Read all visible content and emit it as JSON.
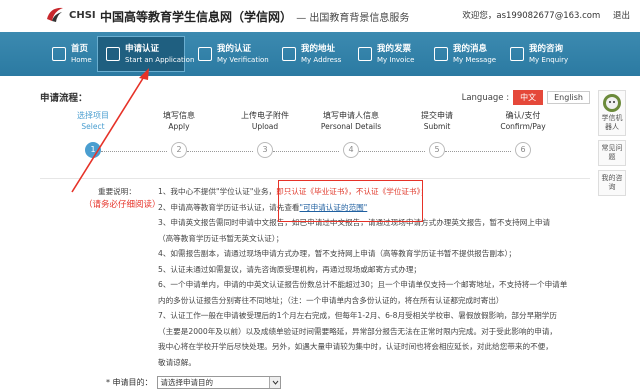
{
  "header": {
    "brand": "CHSI",
    "title": "中国高等教育学生信息网（学信网）",
    "subtitle": "— 出国教育背景信息服务",
    "welcome": "欢迎您，as199082677@163.com",
    "logout": "退出"
  },
  "nav": [
    {
      "cn": "首页",
      "en": "Home",
      "icon": "home-icon"
    },
    {
      "cn": "申请认证",
      "en": "Start an Application",
      "icon": "application-icon"
    },
    {
      "cn": "我的认证",
      "en": "My Verification",
      "icon": "verification-icon"
    },
    {
      "cn": "我的地址",
      "en": "My Address",
      "icon": "address-icon"
    },
    {
      "cn": "我的发票",
      "en": "My Invoice",
      "icon": "invoice-icon"
    },
    {
      "cn": "我的消息",
      "en": "My Message",
      "icon": "message-icon"
    },
    {
      "cn": "我的咨询",
      "en": "My Enquiry",
      "icon": "enquiry-icon"
    }
  ],
  "flow": {
    "title": "申请流程：",
    "language_label": "Language :",
    "lang_cn": "中文",
    "lang_en": "English",
    "steps": [
      {
        "cn": "选择项目",
        "en": "Select",
        "num": "1"
      },
      {
        "cn": "填写信息",
        "en": "Apply",
        "num": "2"
      },
      {
        "cn": "上传电子附件",
        "en": "Upload",
        "num": "3"
      },
      {
        "cn": "填写申请人信息",
        "en": "Personal Details",
        "num": "4"
      },
      {
        "cn": "提交申请",
        "en": "Submit",
        "num": "5"
      },
      {
        "cn": "确认/支付",
        "en": "Confirm/Pay",
        "num": "6"
      }
    ]
  },
  "notes": {
    "label": "重要说明：",
    "line1_a": "1、我中心不提供\"学位认证\"业务，",
    "line1_b": "即只认证《毕业证书》，不认证《学位证书》；",
    "line2_a": "2、申请高等教育学历证书认证，请先查看",
    "line2_link": "\"可申请认证的范围\"",
    "line3": "3、申请英文报告需同时申请中文报告，如已申请过中文报告，请通过现场申请方式办理英文报告，暂不支持网上申请",
    "line3b": "（高等教育学历证书暂无英文认证）；",
    "line4": "4、如需报告副本，请通过现场申请方式办理，暂不支持网上申请（高等教育学历证书暂不提供报告副本）；",
    "line5": "5、认证未通过如需复议，请先咨询原受理机构，再通过现场或邮寄方式办理；",
    "line6": "6、一个申请单内，申请的中英文认证报告份数总计不能超过30；且一个申请单仅支持一个邮寄地址，不支持将一个申请单",
    "line6b": "内的多份认证报告分别寄往不同地址；（注：一个申请单内含多份认证的，将在所有认证都完成时寄出）",
    "line7": "7、认证工作一般在申请被受理后的1个月左右完成，但每年1-2月、6-8月受相关学校审、暑假放假影响，部分早期学历",
    "line7b": "（主要是2000年及以前）以及成绩单验证时间需要略延，异常部分报告无法在正常时限内完成。对于受此影响的申请，",
    "line7c": "我中心将在学校开学后尽快处理。另外，如遇大量申请较为集中时，认证时间也将会相应延长，对此给您带来的不便，",
    "line7d": "敬请谅解。"
  },
  "annotation": {
    "note": "（请务必仔细阅读）"
  },
  "form": {
    "purpose_label": "* 申请目的：",
    "purpose_placeholder": "请选择申请目的"
  },
  "sidebar": {
    "robot": "学信机器人",
    "faq": "常见问题",
    "consult": "我的咨询"
  }
}
